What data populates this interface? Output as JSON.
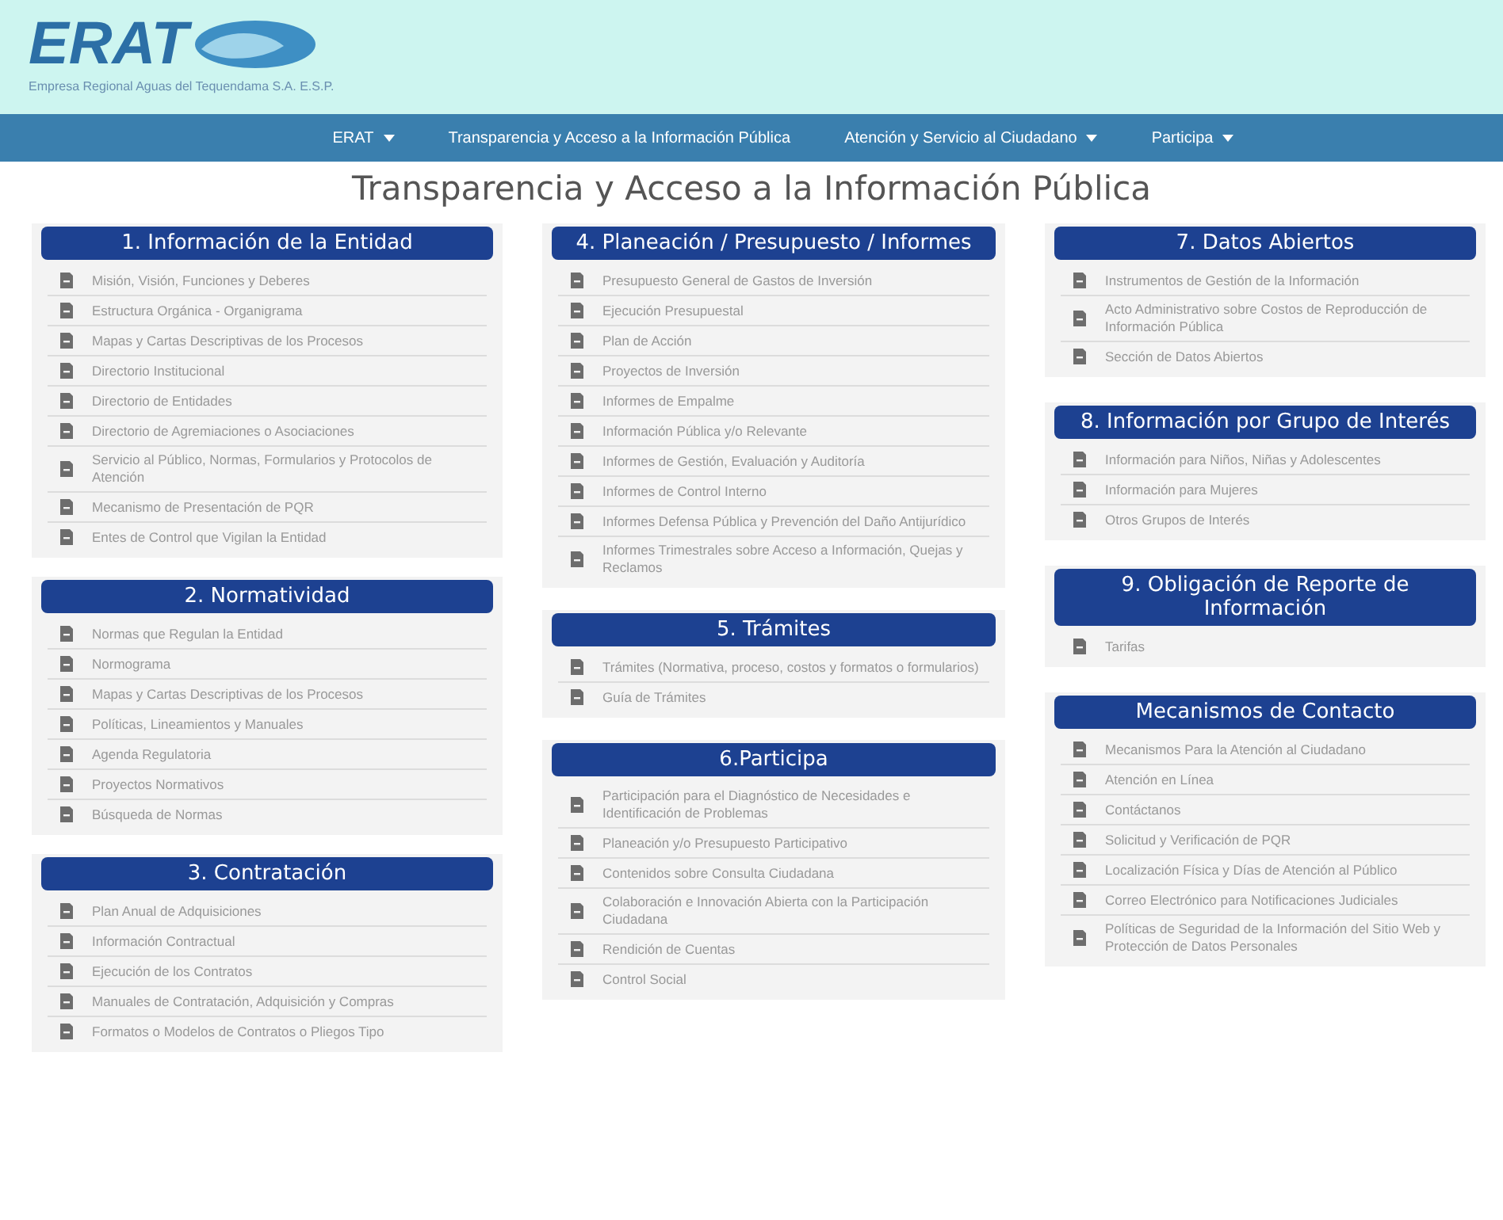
{
  "header": {
    "logo": "ERAT",
    "subtitle": "Empresa Regional Aguas del Tequendama S.A. E.S.P."
  },
  "nav": [
    {
      "label": "ERAT",
      "has_menu": true
    },
    {
      "label": "Transparencia y Acceso a la Información Pública",
      "has_menu": false
    },
    {
      "label": "Atención y Servicio al Ciudadano",
      "has_menu": true
    },
    {
      "label": "Participa",
      "has_menu": true
    }
  ],
  "page_title": "Transparencia y Acceso a la Información Pública",
  "columns": [
    {
      "sections": [
        {
          "title": "1. Información de la Entidad",
          "items": [
            "Misión, Visión, Funciones y Deberes",
            "Estructura Orgánica - Organigrama",
            "Mapas y Cartas Descriptivas de los Procesos",
            "Directorio Institucional",
            "Directorio de Entidades",
            "Directorio de Agremiaciones o Asociaciones",
            "Servicio al Público, Normas, Formularios y Protocolos de Atención",
            "Mecanismo de Presentación de PQR",
            "Entes de Control que Vigilan la Entidad"
          ]
        },
        {
          "title": "2. Normatividad",
          "items": [
            "Normas que Regulan la Entidad",
            "Normograma",
            "Mapas y Cartas Descriptivas de los Procesos",
            "Políticas, Lineamientos y Manuales",
            "Agenda Regulatoria",
            "Proyectos Normativos",
            "Búsqueda de Normas"
          ]
        },
        {
          "title": "3. Contratación",
          "items": [
            "Plan Anual de Adquisiciones",
            "Información Contractual",
            "Ejecución de los Contratos",
            "Manuales de Contratación, Adquisición y Compras",
            "Formatos o Modelos de Contratos o Pliegos Tipo"
          ]
        }
      ]
    },
    {
      "sections": [
        {
          "title": "4. Planeación / Presupuesto / Informes",
          "items": [
            "Presupuesto General de Gastos de Inversión",
            "Ejecución Presupuestal",
            "Plan de Acción",
            "Proyectos de Inversión",
            "Informes de Empalme",
            "Información Pública y/o Relevante",
            "Informes de Gestión, Evaluación y Auditoría",
            "Informes de Control Interno",
            "Informes Defensa Pública y Prevención del Daño Antijurídico",
            "Informes Trimestrales sobre Acceso a Información, Quejas y Reclamos"
          ]
        },
        {
          "title": "5. Trámites",
          "items": [
            "Trámites (Normativa, proceso, costos y formatos o formularios)",
            "Guía de Trámites"
          ]
        },
        {
          "title": "6.Participa",
          "items": [
            "Participación para el Diagnóstico de Necesidades e Identificación de Problemas",
            "Planeación y/o Presupuesto Participativo",
            "Contenidos sobre Consulta Ciudadana",
            "Colaboración e Innovación Abierta con la Participación Ciudadana",
            "Rendición de Cuentas",
            "Control Social"
          ]
        }
      ]
    },
    {
      "sections": [
        {
          "title": "7. Datos Abiertos",
          "items": [
            "Instrumentos de Gestión de la Información",
            "Acto Administrativo sobre Costos de Reproducción de Información Pública",
            "Sección de Datos Abiertos"
          ]
        },
        {
          "title": "8. Información por Grupo de Interés",
          "items": [
            "Información para Niños, Niñas y Adolescentes",
            "Información para Mujeres",
            "Otros Grupos de Interés"
          ]
        },
        {
          "title": "9. Obligación de Reporte de Información",
          "items": [
            "Tarifas"
          ]
        },
        {
          "title": "Mecanismos de Contacto",
          "items": [
            "Mecanismos Para la Atención al Ciudadano",
            "Atención en Línea",
            "Contáctanos",
            "Solicitud y Verificación de PQR",
            "Localización Física y Días de Atención al Público",
            "Correo Electrónico para Notificaciones Judiciales",
            "Políticas de Seguridad de la Información del Sitio Web y Protección de Datos Personales"
          ]
        }
      ]
    }
  ]
}
